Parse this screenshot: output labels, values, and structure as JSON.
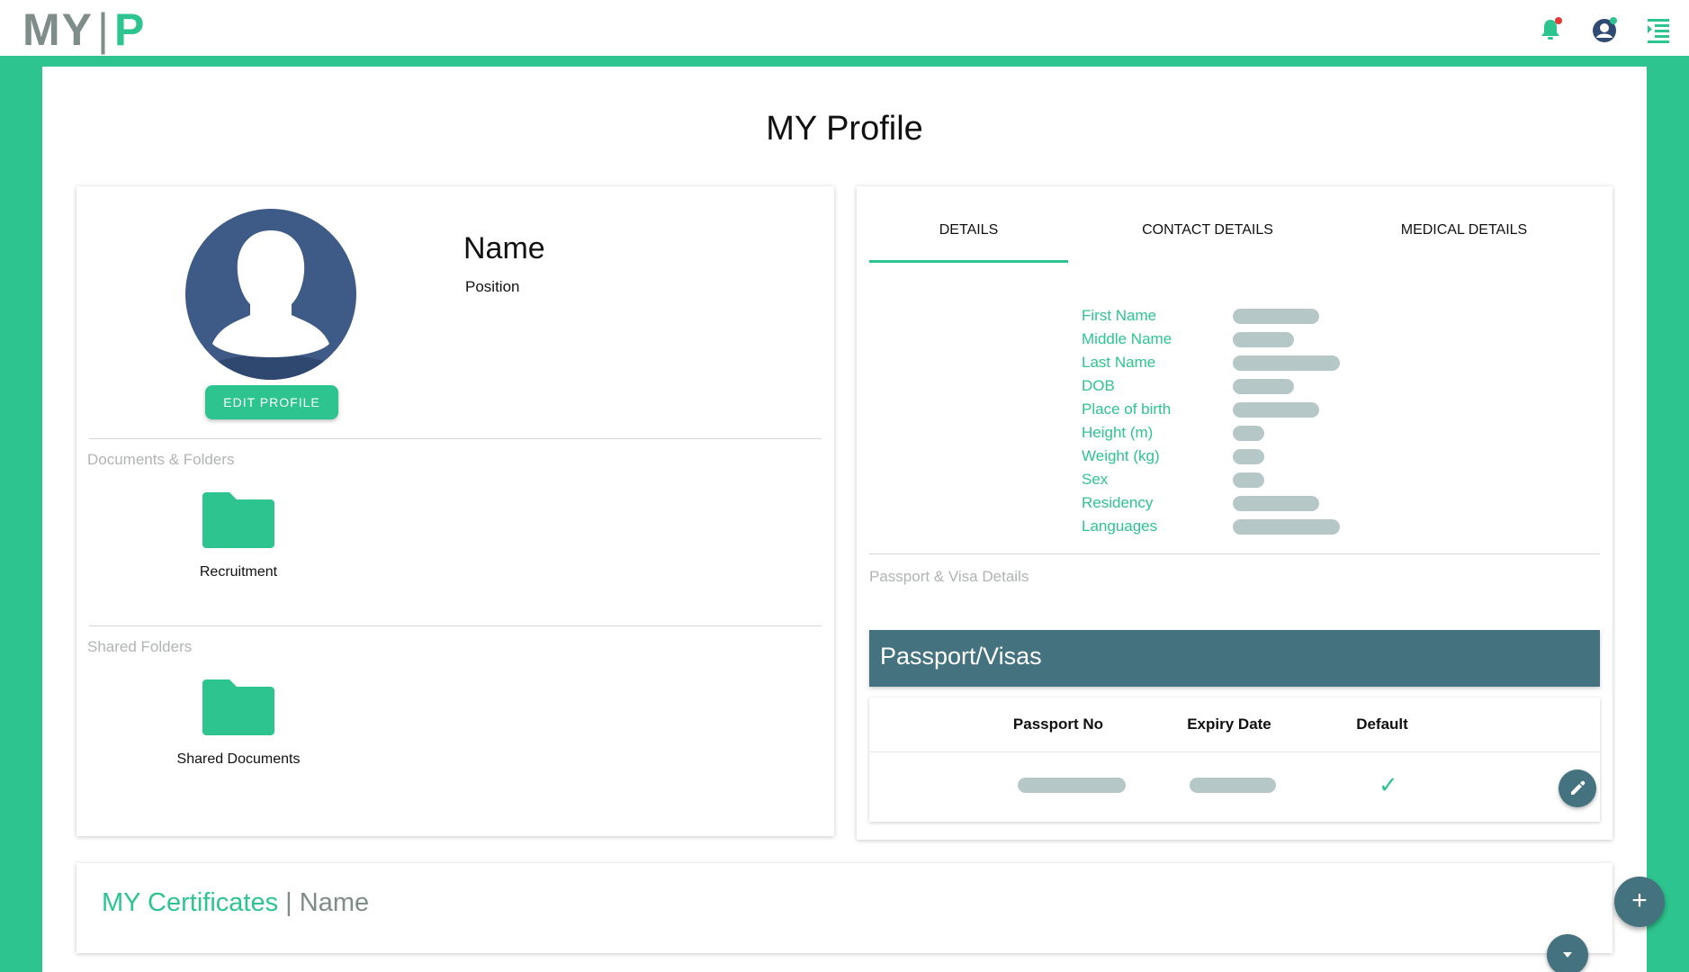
{
  "app": {
    "logo_left": "MY",
    "logo_sep": "|",
    "logo_right": "P",
    "accent_color": "#2ec48f",
    "secondary_color": "#44727f",
    "icons": [
      "bell-icon",
      "account-icon",
      "menu-indent-icon"
    ]
  },
  "page": {
    "title": "MY Profile"
  },
  "profile": {
    "name": "Name",
    "position": "Position",
    "edit_button": "EDIT PROFILE"
  },
  "documents": {
    "section_label": "Documents & Folders",
    "folders": [
      {
        "label": "Recruitment"
      }
    ]
  },
  "shared": {
    "section_label": "Shared Folders",
    "folders": [
      {
        "label": "Shared Documents"
      }
    ]
  },
  "tabs": [
    {
      "label": "DETAILS",
      "active": true
    },
    {
      "label": "CONTACT DETAILS",
      "active": false
    },
    {
      "label": "MEDICAL DETAILS",
      "active": false
    }
  ],
  "details": {
    "fields": [
      {
        "label": "First Name"
      },
      {
        "label": "Middle Name"
      },
      {
        "label": "Last Name"
      },
      {
        "label": "DOB"
      },
      {
        "label": "Place of birth"
      },
      {
        "label": "Height (m)"
      },
      {
        "label": "Weight (kg)"
      },
      {
        "label": "Sex"
      },
      {
        "label": "Residency"
      },
      {
        "label": "Languages"
      }
    ]
  },
  "passport": {
    "section_label": "Passport & Visa Details",
    "header": "Passport/Visas",
    "columns": [
      "Passport No",
      "Expiry Date",
      "Default"
    ],
    "rows": [
      {
        "default": "✓"
      }
    ]
  },
  "certificates": {
    "title_prefix": "MY Certificates",
    "separator": "|",
    "title_suffix": "Name"
  },
  "fab": {
    "add": "+"
  }
}
